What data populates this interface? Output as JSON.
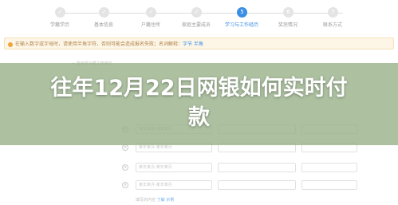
{
  "steps": [
    {
      "label": "学籍学历",
      "num": "✓",
      "active": false
    },
    {
      "label": "基本信息",
      "num": "✓",
      "active": false
    },
    {
      "label": "户籍住所",
      "num": "✓",
      "active": false
    },
    {
      "label": "家庭主要成员",
      "num": "✓",
      "active": false
    },
    {
      "label": "学习与工作经历",
      "num": "5",
      "active": true
    },
    {
      "label": "奖惩情况",
      "num": "6",
      "active": false
    },
    {
      "label": "联系方式",
      "num": "7",
      "active": false
    }
  ],
  "notice": {
    "text": "在输入数字或字母时，请使用半角字符，否则可能会造成报名失败；名词解释：",
    "link": "字节 半角"
  },
  "form": {
    "section_label": "+ 您全学习或工作单位",
    "row_placeholder": "某年某月-某年某月",
    "hint_text": "填写的内容 ",
    "hint_accent": "了解 ",
    "hint_link": "示例"
  },
  "overlay": {
    "title_line1": "往年12月22日网银如何实时付",
    "title_line2": "款"
  },
  "colors": {
    "accent": "#3a8ee6",
    "notice_bg": "#fdf6e7",
    "overlay": "#96af87"
  }
}
